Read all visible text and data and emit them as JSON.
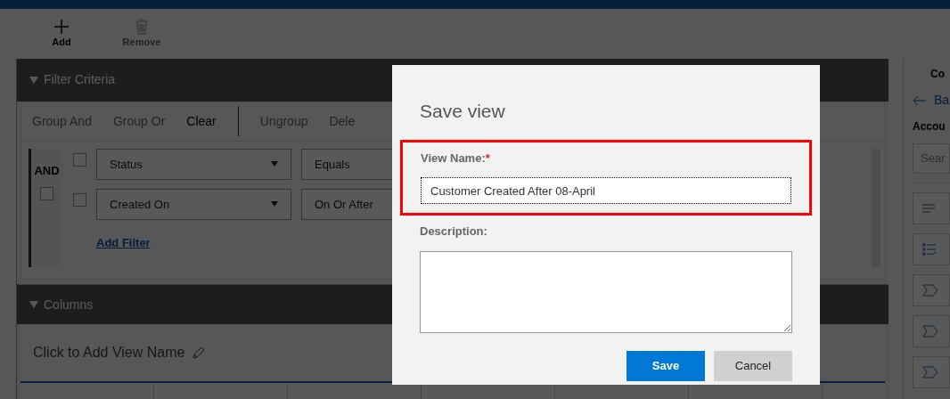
{
  "toolbar": [
    {
      "label": "Add",
      "kind": "add",
      "disabled": false
    },
    {
      "label": "Remove",
      "kind": "remove",
      "disabled": true
    }
  ],
  "filter_panel": {
    "title": "Filter Criteria",
    "expanded": true,
    "actions": [
      {
        "label": "Group And",
        "disabled": true
      },
      {
        "label": "Group Or",
        "disabled": true
      },
      {
        "label": "Clear",
        "disabled": false
      },
      {
        "label": "Ungroup",
        "disabled": true
      },
      {
        "label": "Dele",
        "disabled": true
      }
    ],
    "group": {
      "operator": "AND",
      "checked": false,
      "rows": [
        {
          "checked": false,
          "field": "Status",
          "condition": "Equals"
        },
        {
          "checked": false,
          "field": "Created On",
          "condition": "On Or After"
        }
      ]
    },
    "add_filter": "Add Filter"
  },
  "columns_panel": {
    "title": "Columns",
    "expanded": true,
    "view_name_prompt": "Click to Add View Name"
  },
  "side_panel": {
    "title": "Co",
    "back": "Ba",
    "section": "Accou",
    "search_placeholder": "Sear",
    "items": [
      {
        "kind": "lines"
      },
      {
        "kind": "checklist"
      },
      {
        "kind": "tag"
      },
      {
        "kind": "tag"
      },
      {
        "kind": "tag"
      }
    ]
  },
  "dialog": {
    "title": "Save view",
    "name_label": "View Name:",
    "required_mark": "*",
    "name_value": "Customer Created After 08-April",
    "highlighted": true,
    "description_label": "Description:",
    "buttons": [
      {
        "label": "Save",
        "primary": true
      },
      {
        "label": "Cancel",
        "primary": false
      }
    ]
  }
}
